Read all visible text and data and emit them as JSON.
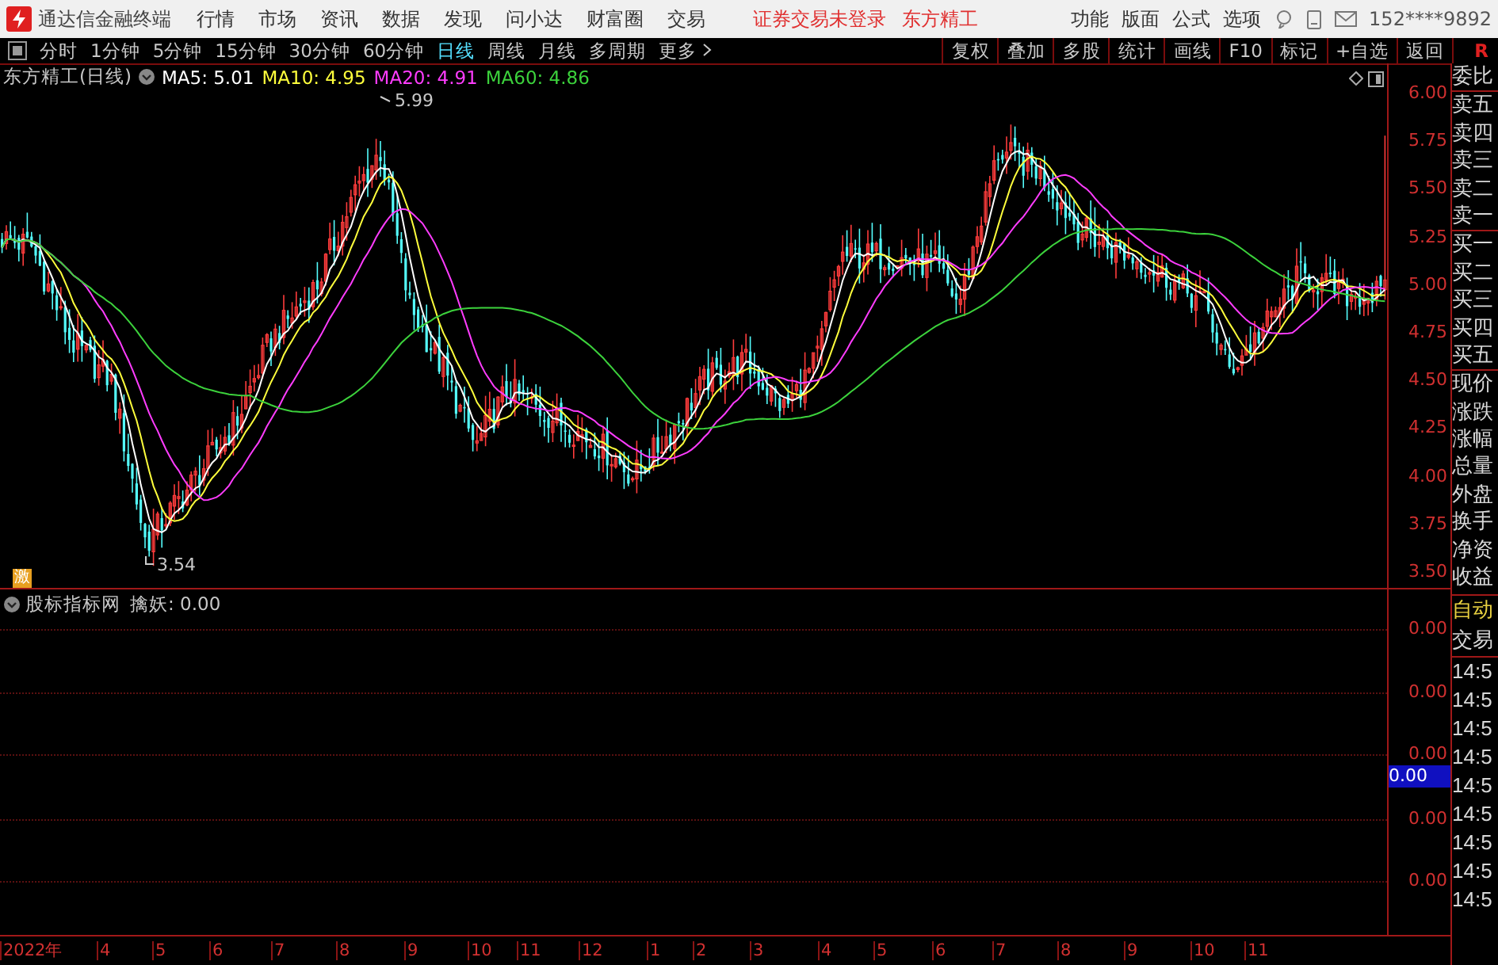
{
  "title_bar": {
    "app_name": "通达信金融终端",
    "menus": [
      "行情",
      "市场",
      "资讯",
      "数据",
      "发现",
      "问小达",
      "财富圈",
      "交易"
    ],
    "login_status": "证券交易未登录",
    "stock_name": "东方精工",
    "right_menus": [
      "功能",
      "版面",
      "公式",
      "选项"
    ],
    "account": "152****9892"
  },
  "toolbar": {
    "periods": [
      {
        "label": "分时",
        "selected": false
      },
      {
        "label": "1分钟",
        "selected": false
      },
      {
        "label": "5分钟",
        "selected": false
      },
      {
        "label": "15分钟",
        "selected": false
      },
      {
        "label": "30分钟",
        "selected": false
      },
      {
        "label": "60分钟",
        "selected": false
      },
      {
        "label": "日线",
        "selected": true
      },
      {
        "label": "周线",
        "selected": false
      },
      {
        "label": "月线",
        "selected": false
      },
      {
        "label": "多周期",
        "selected": false
      },
      {
        "label": "更多",
        "selected": false
      }
    ],
    "buttons": [
      "复权",
      "叠加",
      "多股",
      "统计",
      "画线",
      "F10",
      "标记",
      "+自选",
      "返回"
    ],
    "corner": "R"
  },
  "price_pane": {
    "title": "东方精工(日线)",
    "ma": [
      {
        "label": "MA5: 5.01",
        "color": "#ffffff"
      },
      {
        "label": "MA10: 4.95",
        "color": "#ffff3c"
      },
      {
        "label": "MA20: 4.91",
        "color": "#ff3cff"
      },
      {
        "label": "MA60: 4.86",
        "color": "#3cd23c"
      }
    ],
    "high_label": "5.99",
    "low_label": "3.54",
    "tag": "激",
    "axis": [
      "6.00",
      "5.75",
      "5.50",
      "5.25",
      "5.00",
      "4.75",
      "4.50",
      "4.25",
      "4.00",
      "3.75",
      "3.50"
    ]
  },
  "indicator_pane": {
    "name": "股标指标网",
    "value": "擒妖: 0.00",
    "axis": [
      "0.00",
      "0.00",
      "0.00",
      "0.00",
      "0.00"
    ],
    "cursor_value": "0.00"
  },
  "side_panel": {
    "quote_labels": [
      "委比",
      "卖五",
      "卖四",
      "卖三",
      "卖二",
      "卖一",
      "买一",
      "买二",
      "买三",
      "买四",
      "买五",
      "现价",
      "涨跌",
      "涨幅",
      "总量",
      "外盘",
      "换手",
      "净资",
      "收益"
    ],
    "auto_label": "自动",
    "trade_label": "交易",
    "times": [
      "14:5",
      "14:5",
      "14:5",
      "14:5",
      "14:5",
      "14:5",
      "14:5",
      "14:5",
      "14:5"
    ]
  },
  "x_axis": [
    "2022年",
    "4",
    "5",
    "6",
    "7",
    "8",
    "9",
    "10",
    "11",
    "12",
    "1",
    "2",
    "3",
    "4",
    "5",
    "6",
    "7",
    "8",
    "9",
    "10",
    "11"
  ]
}
